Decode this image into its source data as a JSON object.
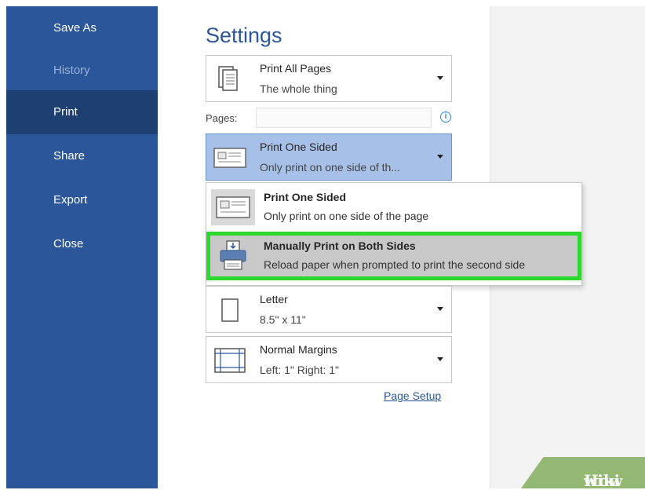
{
  "sidebar": {
    "items": [
      {
        "label": "Save As",
        "state": "normal"
      },
      {
        "label": "History",
        "state": "disabled"
      },
      {
        "label": "Print",
        "state": "active"
      },
      {
        "label": "Share",
        "state": "normal"
      },
      {
        "label": "Export",
        "state": "normal"
      },
      {
        "label": "Close",
        "state": "normal"
      }
    ]
  },
  "settings": {
    "heading": "Settings",
    "pages_dropdown": {
      "title": "Print All Pages",
      "subtitle": "The whole thing"
    },
    "pages_label": "Pages:",
    "pages_input_value": "",
    "sides_dropdown": {
      "title": "Print One Sided",
      "subtitle": "Only print on one side of th..."
    },
    "sides_menu": [
      {
        "title": "Print One Sided",
        "subtitle": "Only print on one side of the page",
        "highlighted": false
      },
      {
        "title": "Manually Print on Both Sides",
        "subtitle": "Reload paper when prompted to print the second side",
        "highlighted": true
      }
    ],
    "paper_dropdown": {
      "title": "Letter",
      "subtitle": "8.5\" x 11\""
    },
    "margins_dropdown": {
      "title": "Normal Margins",
      "subtitle": "Left:  1\"    Right:  1\""
    },
    "page_setup_link": "Page Setup"
  },
  "watermark": {
    "part1": "wiki",
    "part2": "How"
  },
  "colors": {
    "sidebar": "#2b579a",
    "sidebar_active": "#1e3f72",
    "selected_dropdown": "#a7c0e8",
    "highlight_border": "#2fd82f",
    "highlight_fill": "#c8c8c8"
  },
  "icons": [
    "pages-icon",
    "one-sided-icon",
    "printer-duplex-icon",
    "paper-icon",
    "margins-icon",
    "info-icon",
    "caret-down-icon"
  ]
}
